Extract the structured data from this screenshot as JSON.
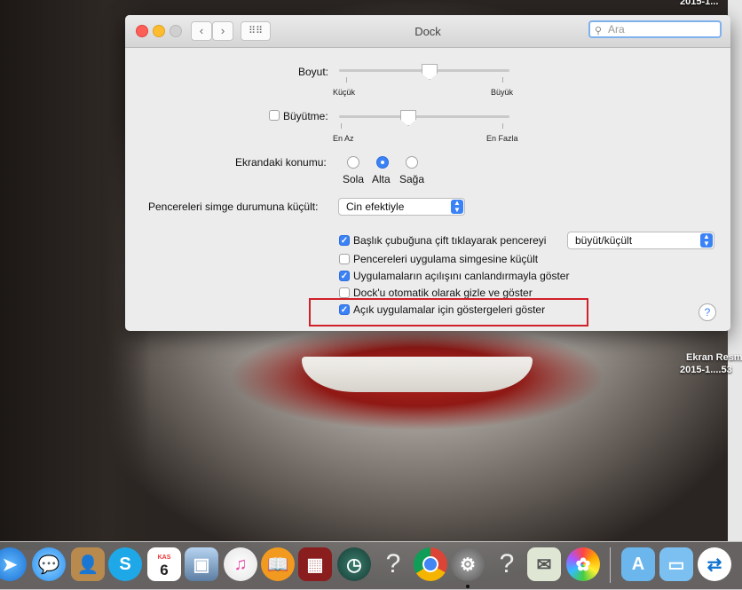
{
  "window": {
    "title": "Dock",
    "search_placeholder": "Ara"
  },
  "size": {
    "label": "Boyut:",
    "min_label": "Küçük",
    "max_label": "Büyük",
    "value": 0.5
  },
  "magnification": {
    "label": "Büyütme:",
    "checked": false,
    "min_label": "En Az",
    "max_label": "En Fazla",
    "value": 0.4
  },
  "position": {
    "label": "Ekrandaki konumu:",
    "options": [
      "Sola",
      "Alta",
      "Sağa"
    ],
    "selected": "Alta"
  },
  "minimize": {
    "label": "Pencereleri simge durumuna küçült:",
    "value": "Cin efektiyle"
  },
  "options": [
    {
      "label": "Başlık çubuğuna çift tıklayarak pencereyi",
      "checked": true
    },
    {
      "label": "Pencereleri uygulama simgesine küçült",
      "checked": false
    },
    {
      "label": "Uygulamaların açılışını canlandırmayla göster",
      "checked": true
    },
    {
      "label": "Dock'u otomatik olarak gizle ve göster",
      "checked": false
    },
    {
      "label": "Açık uygulamalar için göstergeleri göster",
      "checked": true
    }
  ],
  "double_click_action": {
    "value": "büyüt/küçült"
  },
  "help_label": "?",
  "desktop": {
    "top_right_label": "2015-1...",
    "file_label_1": "Ekran Resm",
    "file_label_2": "2015-1....53"
  },
  "dock": {
    "calendar_month": "KAS",
    "calendar_day": "6",
    "unknown_label": "?",
    "icons": [
      "safari-icon",
      "messages-icon",
      "contacts-icon",
      "skype-icon",
      "calendar-icon",
      "preview-icon",
      "itunes-icon",
      "ibooks-icon",
      "photo-booth-icon",
      "time-machine-icon",
      "unknown-app-icon",
      "chrome-icon",
      "system-preferences-icon",
      "unknown-app-icon",
      "image-capture-icon",
      "photos-icon",
      "applications-folder-icon",
      "documents-folder-icon",
      "teamviewer-icon"
    ]
  }
}
